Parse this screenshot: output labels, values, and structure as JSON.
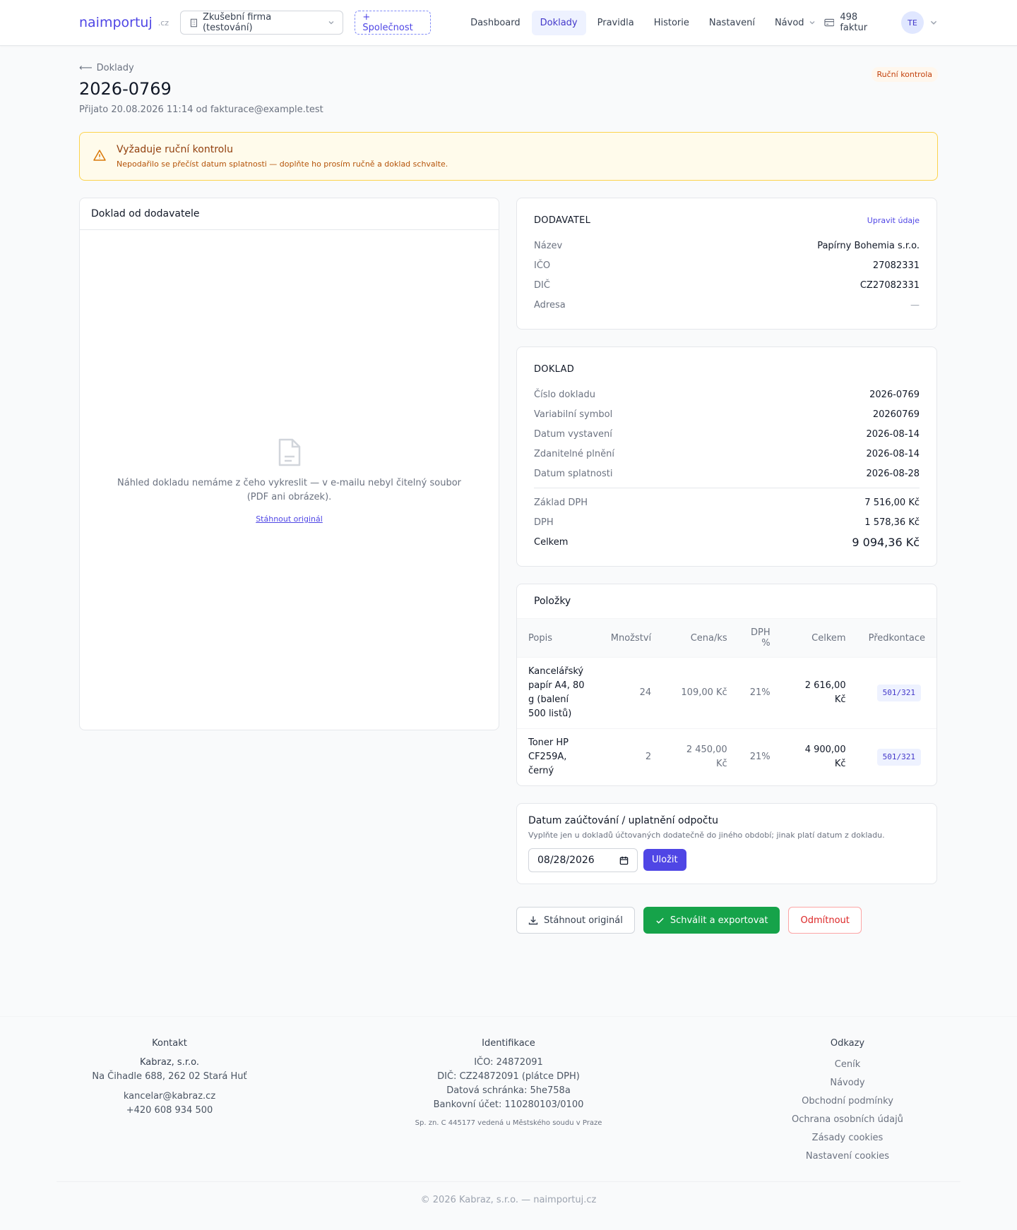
{
  "header": {
    "logo": "naimportuj",
    "logo_tld": ".cz",
    "company": "Zkušební firma (testování)",
    "add_company": "+ Společnost",
    "nav": [
      {
        "label": "Dashboard",
        "active": false
      },
      {
        "label": "Doklady",
        "active": true
      },
      {
        "label": "Pravidla",
        "active": false
      },
      {
        "label": "Historie",
        "active": false
      },
      {
        "label": "Nastavení",
        "active": false
      },
      {
        "label": "Návod",
        "active": false
      }
    ],
    "invoice_count": "498 faktur",
    "avatar_initials": "TE"
  },
  "page": {
    "back_label": "Doklady",
    "title": "2026-0769",
    "subtitle": "Přijato 20.08.2026 11:14 od fakturace@example.test",
    "status": "Ruční kontrola"
  },
  "alert": {
    "title": "Vyžaduje ruční kontrolu",
    "description": "Nepodařilo se přečíst datum splatnosti — doplňte ho prosím ručně a doklad schvalte."
  },
  "preview": {
    "title": "Doklad od dodavatele",
    "message": "Náhled dokladu nemáme z čeho vykreslit — v e-mailu nebyl čitelný soubor (PDF ani obrázek).",
    "download_link": "Stáhnout originál"
  },
  "supplier": {
    "title": "DODAVATEL",
    "edit_label": "Upravit údaje",
    "rows": [
      {
        "label": "Název",
        "value": "Papírny Bohemia s.r.o."
      },
      {
        "label": "IČO",
        "value": "27082331"
      },
      {
        "label": "DIČ",
        "value": "CZ27082331"
      },
      {
        "label": "Adresa",
        "value": "—"
      }
    ]
  },
  "document": {
    "title": "DOKLAD",
    "rows": [
      {
        "label": "Číslo dokladu",
        "value": "2026-0769"
      },
      {
        "label": "Variabilní symbol",
        "value": "20260769"
      },
      {
        "label": "Datum vystavení",
        "value": "2026-08-14"
      },
      {
        "label": "Zdanitelné plnění",
        "value": "2026-08-14"
      },
      {
        "label": "Datum splatnosti",
        "value": "2026-08-28"
      }
    ],
    "totals": [
      {
        "label": "Základ DPH",
        "value": "7 516,00 Kč"
      },
      {
        "label": "DPH",
        "value": "1 578,36 Kč"
      }
    ],
    "total": {
      "label": "Celkem",
      "value": "9 094,36 Kč"
    }
  },
  "items": {
    "title": "Položky",
    "columns": [
      "Popis",
      "Množství",
      "Cena/ks",
      "DPH %",
      "Celkem",
      "Předkontace"
    ],
    "rows": [
      {
        "desc": "Kancelářský papír A4, 80 g (balení 500 listů)",
        "qty": "24",
        "price": "109,00 Kč",
        "vat": "21%",
        "total": "2 616,00 Kč",
        "account": "501/321"
      },
      {
        "desc": "Toner HP CF259A, černý",
        "qty": "2",
        "price": "2 450,00 Kč",
        "vat": "21%",
        "total": "4 900,00 Kč",
        "account": "501/321"
      }
    ]
  },
  "posting": {
    "title": "Datum zaúčtování / uplatnění odpočtu",
    "description": "Vyplňte jen u dokladů účtovaných dodatečně do jiného období; jinak platí datum z dokladu.",
    "date_value": "08/28/2026",
    "save_label": "Uložit"
  },
  "actions": {
    "download": "Stáhnout originál",
    "approve": "Schválit a exportovat",
    "reject": "Odmítnout"
  },
  "footer": {
    "contact": {
      "title": "Kontakt",
      "company": "Kabraz, s.r.o.",
      "address": "Na Čihadle 688, 262 02 Stará Huť",
      "email": "kancelar@kabraz.cz",
      "phone": "+420 608 934 500"
    },
    "identification": {
      "title": "Identifikace",
      "ico": "IČO: 24872091",
      "dic": "DIČ: CZ24872091 (plátce DPH)",
      "databox": "Datová schránka: 5he758a",
      "bank": "Bankovní účet: 110280103/0100",
      "registry": "Sp. zn. C 445177 vedená u Městského soudu v Praze"
    },
    "links": {
      "title": "Odkazy",
      "items": [
        "Ceník",
        "Návody",
        "Obchodní podmínky",
        "Ochrana osobních údajů",
        "Zásady cookies",
        "Nastavení cookies"
      ]
    },
    "copyright": "© 2026 Kabraz, s.r.o. — naimportuj.cz"
  }
}
